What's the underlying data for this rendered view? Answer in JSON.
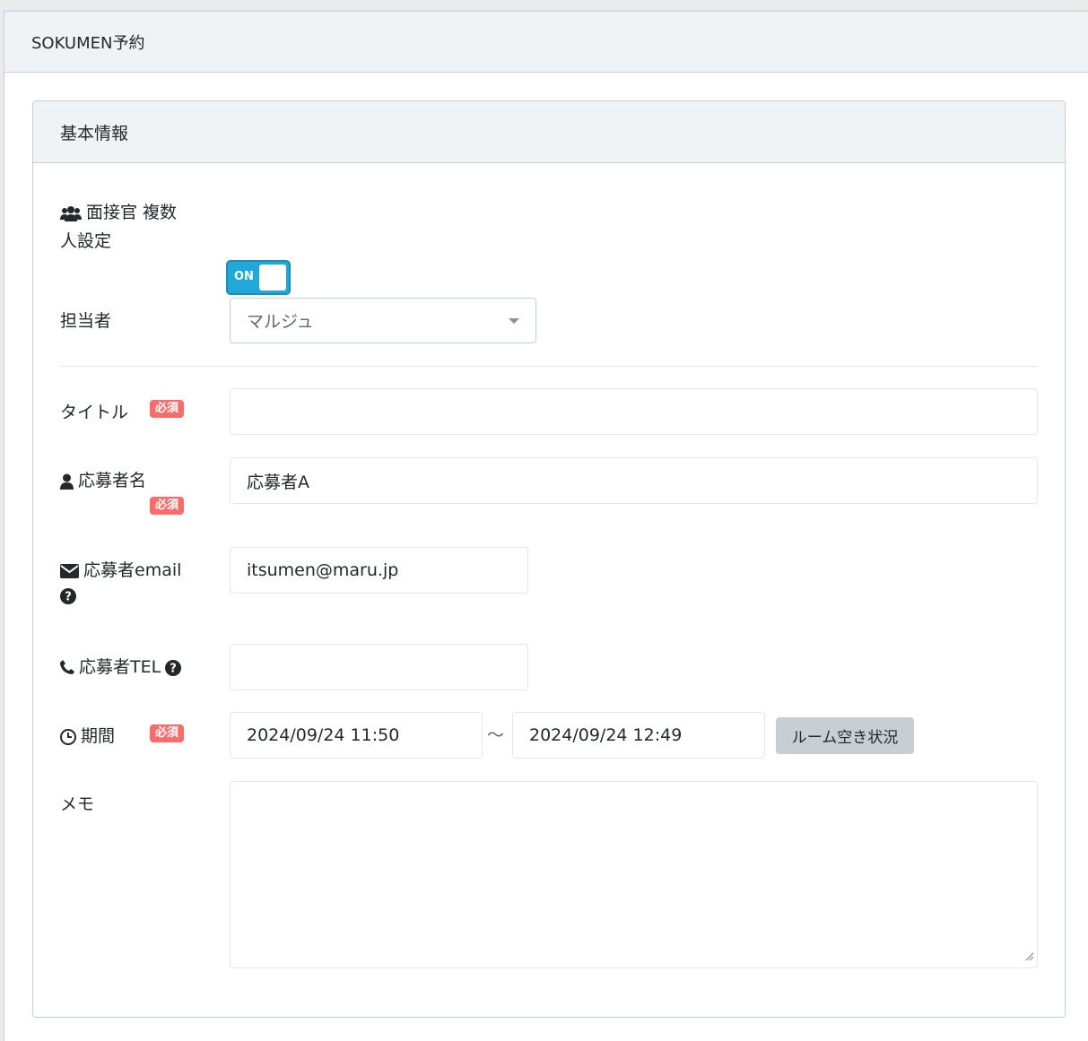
{
  "app": {
    "title": "SOKUMEN予約"
  },
  "card": {
    "title": "基本情報"
  },
  "multi_interviewer": {
    "label_line1": "面接官 複数",
    "label_line2": "人設定",
    "toggle_text": "ON"
  },
  "assignee": {
    "label": "担当者",
    "value": "マルジュ"
  },
  "title_field": {
    "label": "タイトル",
    "required": "必須",
    "value": ""
  },
  "applicant_name": {
    "label": "応募者名",
    "required": "必須",
    "value": "応募者A"
  },
  "applicant_email": {
    "label": "応募者email",
    "value": "itsumen@maru.jp"
  },
  "applicant_tel": {
    "label": "応募者TEL",
    "value": ""
  },
  "period": {
    "label": "期間",
    "required": "必須",
    "start": "2024/09/24 11:50",
    "separator": "～",
    "end": "2024/09/24 12:49",
    "room_button": "ルーム空き状況"
  },
  "memo": {
    "label": "メモ",
    "value": ""
  }
}
